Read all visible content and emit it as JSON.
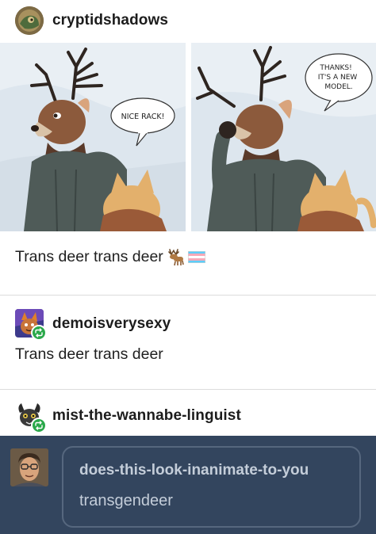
{
  "post": {
    "author": "cryptidshadows",
    "comic": {
      "panel1_bubble": "NICE RACK!",
      "panel2_bubble": [
        "THANKS!",
        "IT'S A NEW",
        "MODEL."
      ]
    },
    "caption": "Trans deer trans deer"
  },
  "reblogs": [
    {
      "username": "demoisverysexy",
      "text": "Trans deer trans deer"
    },
    {
      "username": "mist-the-wannabe-linguist",
      "text": ""
    }
  ],
  "reply": {
    "username": "does-this-look-inanimate-to-you",
    "text": "transgendeer"
  },
  "colors": {
    "sky": "#dde6ee",
    "deer_fur": "#8c5a3c",
    "hoodie": "#4f5b58",
    "fox_fur": "#e3b06c",
    "fox_hoodie": "#9a5a38",
    "reblog_green": "#2aa84a",
    "dark_bg": "#33455e"
  }
}
